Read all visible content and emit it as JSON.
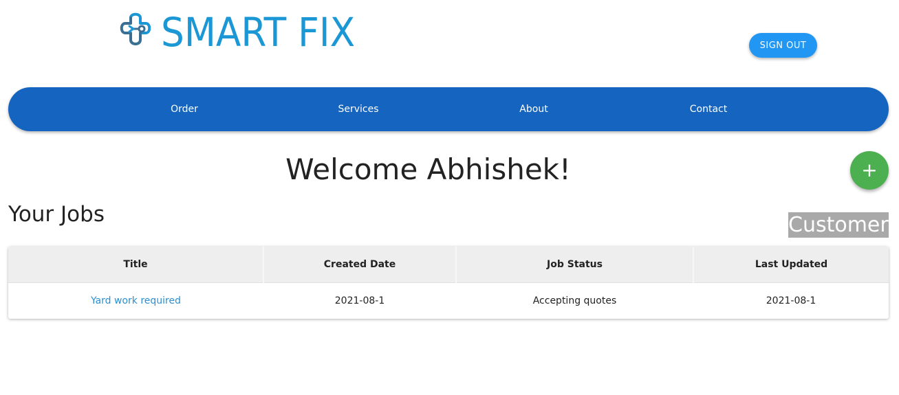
{
  "header": {
    "logo_text": "SMART FIX",
    "logo_icon": "cloud-wrench-logo-icon",
    "sign_out_label": "SIGN OUT"
  },
  "nav": {
    "items": [
      {
        "label": "Order"
      },
      {
        "label": "Services"
      },
      {
        "label": "About"
      },
      {
        "label": "Contact"
      }
    ]
  },
  "main": {
    "welcome": "Welcome Abhishek!",
    "add_button_label": "+",
    "jobs_heading": "Your Jobs",
    "role_badge": "Customer"
  },
  "jobs_table": {
    "columns": [
      "Title",
      "Created Date",
      "Job Status",
      "Last Updated"
    ],
    "rows": [
      {
        "title": "Yard work required",
        "created_date": "2021-08-1",
        "status": "Accepting quotes",
        "last_updated": "2021-08-1"
      }
    ]
  },
  "colors": {
    "brand": "#1a97d4",
    "nav_bg": "#1565c0",
    "sign_out_bg": "#2196f3",
    "fab_bg": "#4caf50",
    "link": "#2b8fd0",
    "badge_bg": "#a9a9a9"
  }
}
